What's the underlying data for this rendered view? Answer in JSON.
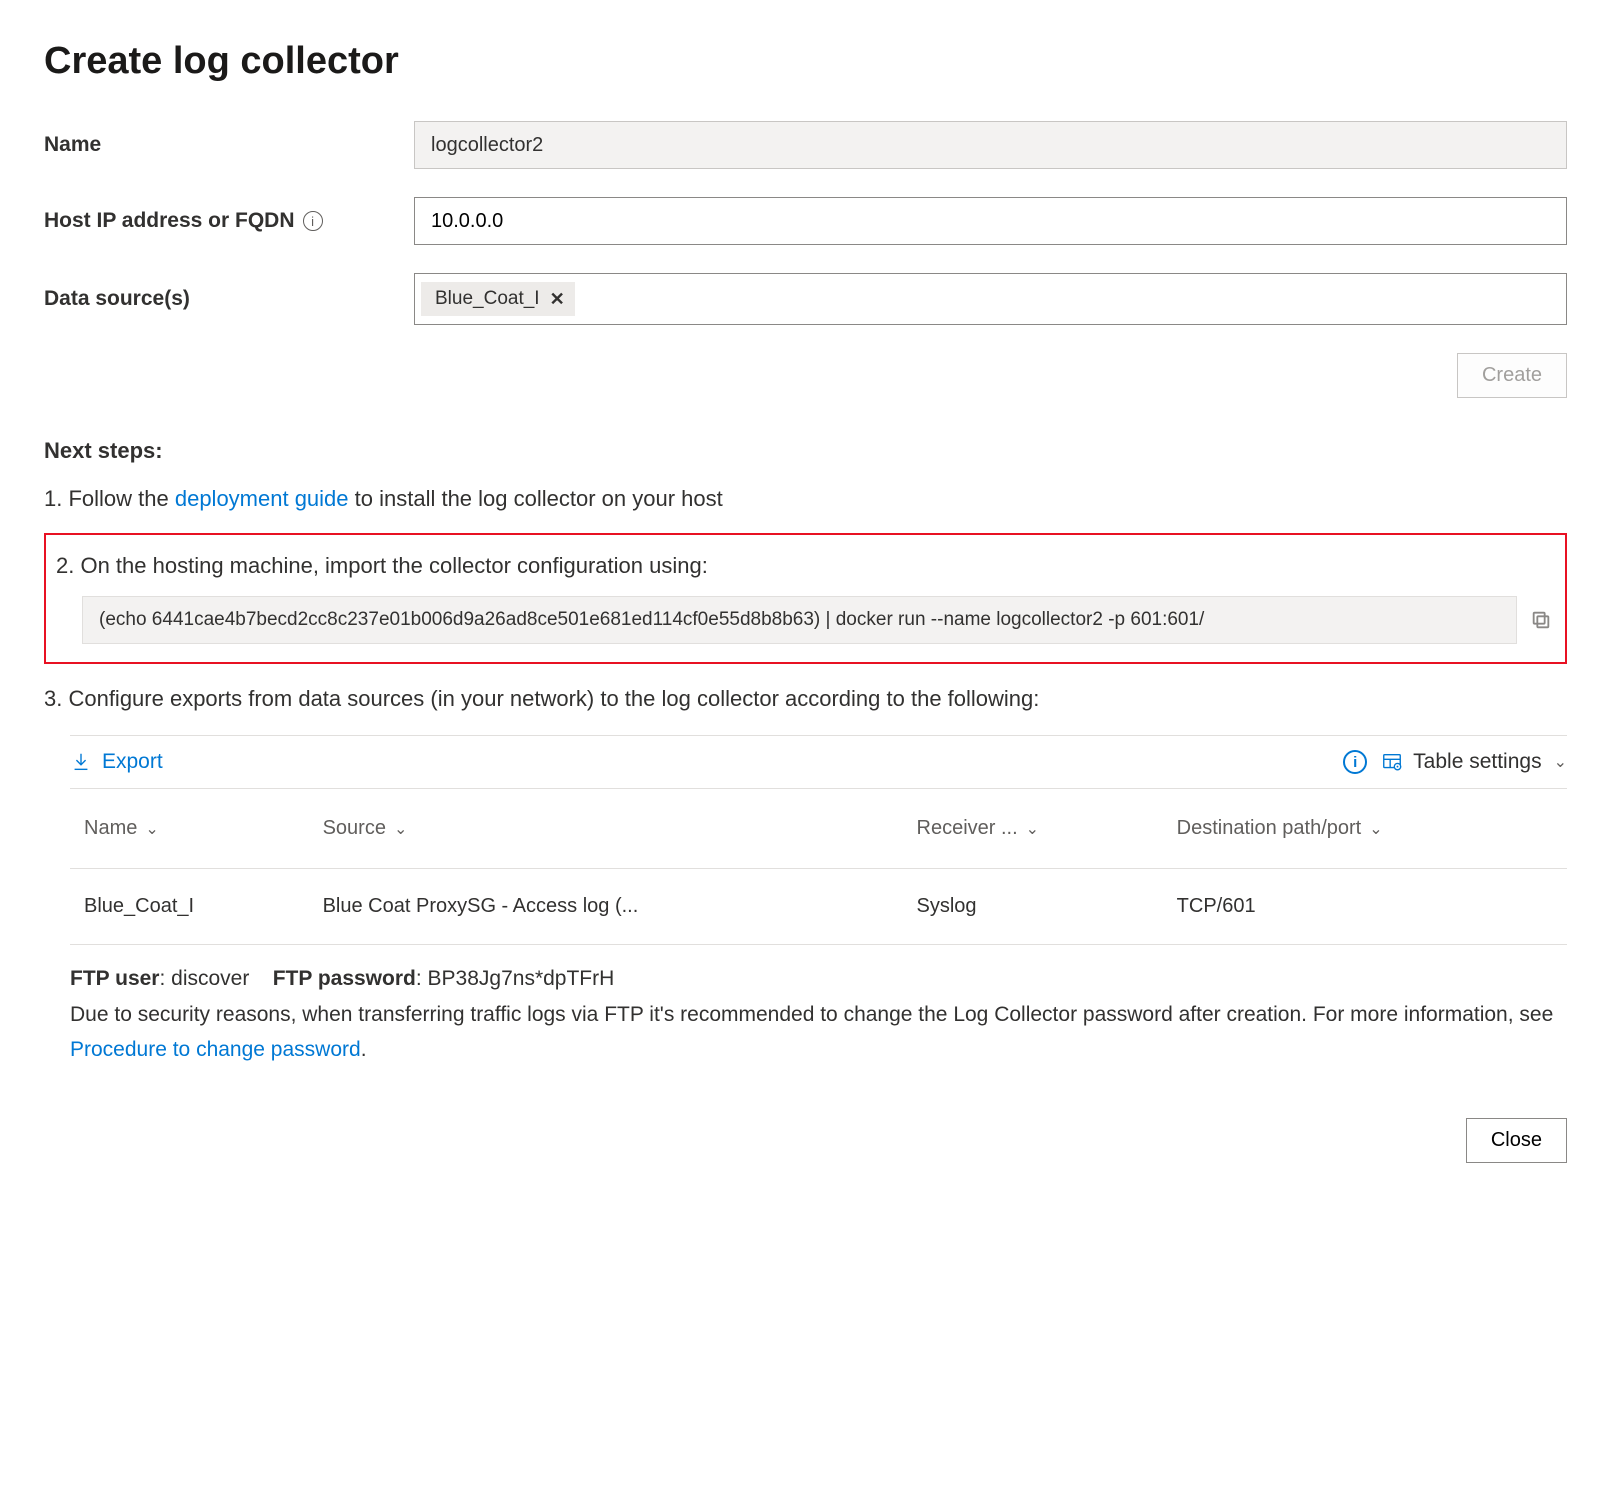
{
  "title": "Create log collector",
  "form": {
    "name_label": "Name",
    "name_value": "logcollector2",
    "host_label": "Host IP address or FQDN",
    "host_value": "10.0.0.0",
    "sources_label": "Data source(s)",
    "source_tag": "Blue_Coat_I"
  },
  "create_button": "Create",
  "next_steps_heading": "Next steps:",
  "steps": {
    "s1_prefix": "1. Follow the ",
    "s1_link": "deployment guide",
    "s1_suffix": " to install the log collector on your host",
    "s2": "2. On the hosting machine, import the collector configuration using:",
    "s2_code": "(echo 6441cae4b7becd2cc8c237e01b006d9a26ad8ce501e681ed114cf0e55d8b8b63) | docker run --name logcollector2 -p 601:601/",
    "s3": "3. Configure exports from data sources (in your network) to the log collector according to the following:"
  },
  "toolbar": {
    "export": "Export",
    "table_settings": "Table settings"
  },
  "table": {
    "columns": {
      "name": "Name",
      "source": "Source",
      "receiver": "Receiver ...",
      "dest": "Destination path/port"
    },
    "row": {
      "name": "Blue_Coat_I",
      "source": "Blue Coat ProxySG - Access log (...",
      "receiver": "Syslog",
      "dest": "TCP/601"
    }
  },
  "ftp": {
    "user_label": "FTP user",
    "user_value": "discover",
    "pwd_label": "FTP password",
    "pwd_value": "BP38Jg7ns*dpTFrH",
    "note_prefix": "Due to security reasons, when transferring traffic logs via FTP it's recommended to change the Log Collector password after creation. For more information, see ",
    "note_link": "Procedure to change password",
    "note_suffix": "."
  },
  "close_button": "Close"
}
